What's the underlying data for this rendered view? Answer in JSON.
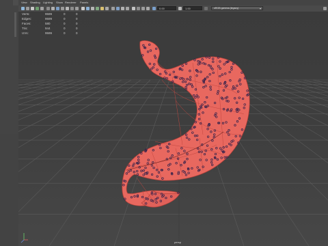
{
  "menu": [
    "View",
    "Shading",
    "Lighting",
    "Show",
    "Renderer",
    "Panels"
  ],
  "toolbar": {
    "field1": "0.00",
    "field2": "1.00",
    "colorspace": "sRGB gamma (legacy)"
  },
  "hud": {
    "rows": [
      {
        "label": "Verts:",
        "v1": "9599",
        "v2": "0",
        "v3": "0"
      },
      {
        "label": "Edges:",
        "v1": "9599",
        "v2": "0",
        "v3": "0"
      },
      {
        "label": "Faces:",
        "v1": "580",
        "v2": "0",
        "v3": "0"
      },
      {
        "label": "Tris:",
        "v1": "944",
        "v2": "0",
        "v3": "0"
      },
      {
        "label": "UVs:",
        "v1": "9599",
        "v2": "0",
        "v3": "0"
      }
    ]
  },
  "camera_label": "persp",
  "colors": {
    "model_fill": "#e8685f",
    "model_wire": "#b3403a",
    "vertex_dot": "#2b1f4a",
    "grid_line": "#5a5a5a"
  }
}
